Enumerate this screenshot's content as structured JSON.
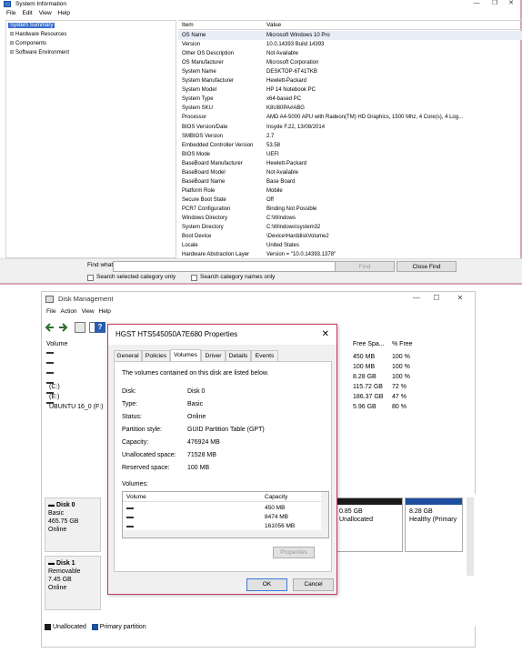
{
  "sysinfo": {
    "title": "System Information",
    "menu": [
      "File",
      "Edit",
      "View",
      "Help"
    ],
    "window_buttons": [
      "—",
      "❐",
      "✕"
    ],
    "tree": [
      {
        "label": "System Summary",
        "selected": true,
        "expander": ""
      },
      {
        "label": "Hardware Resources",
        "selected": false,
        "expander": "⊞"
      },
      {
        "label": "Components",
        "selected": false,
        "expander": "⊞"
      },
      {
        "label": "Software Environment",
        "selected": false,
        "expander": "⊞"
      }
    ],
    "columns": {
      "item": "Item",
      "value": "Value"
    },
    "rows": [
      {
        "item": "OS Name",
        "value": "Microsoft Windows 10 Pro"
      },
      {
        "item": "Version",
        "value": "10.0.14393 Build 14393"
      },
      {
        "item": "Other OS Description",
        "value": "Not Available"
      },
      {
        "item": "OS Manufacturer",
        "value": "Microsoft Corporation"
      },
      {
        "item": "System Name",
        "value": "DESKTOP-6T41TKB"
      },
      {
        "item": "System Manufacturer",
        "value": "Hewlett-Packard"
      },
      {
        "item": "System Model",
        "value": "HP 14 Notebook PC"
      },
      {
        "item": "System Type",
        "value": "x64-based PC"
      },
      {
        "item": "System SKU",
        "value": "K8U80PA#ABG"
      },
      {
        "item": "Processor",
        "value": "AMD A4-5000 APU with Radeon(TM) HD Graphics, 1500 Mhz, 4 Core(s), 4 Log..."
      },
      {
        "item": "BIOS Version/Date",
        "value": "Insyde F.22, 13/08/2014"
      },
      {
        "item": "SMBIOS Version",
        "value": "2.7"
      },
      {
        "item": "Embedded Controller Version",
        "value": "53.58"
      },
      {
        "item": "BIOS Mode",
        "value": "UEFI"
      },
      {
        "item": "BaseBoard Manufacturer",
        "value": "Hewlett-Packard"
      },
      {
        "item": "BaseBoard Model",
        "value": "Not Available"
      },
      {
        "item": "BaseBoard Name",
        "value": "Base Board"
      },
      {
        "item": "Platform Role",
        "value": "Mobile"
      },
      {
        "item": "Secure Boot State",
        "value": "Off"
      },
      {
        "item": "PCR7 Configuration",
        "value": "Binding Not Possible"
      },
      {
        "item": "Windows Directory",
        "value": "C:\\Windows"
      },
      {
        "item": "System Directory",
        "value": "C:\\Windows\\system32"
      },
      {
        "item": "Boot Device",
        "value": "\\Device\\HarddiskVolume2"
      },
      {
        "item": "Locale",
        "value": "United States"
      },
      {
        "item": "Hardware Abstraction Layer",
        "value": "Version = \"10.0.14393.1378\""
      }
    ],
    "find": {
      "label": "Find what:",
      "value": "",
      "find_button": "Find",
      "close_find_button": "Close Find",
      "search_selected_label": "Search selected category only",
      "search_names_label": "Search category names only"
    }
  },
  "diskmgmt": {
    "title": "Disk Management",
    "menu": [
      "File",
      "Action",
      "View",
      "Help"
    ],
    "window_buttons": [
      "—",
      "☐",
      "✕"
    ],
    "columns": {
      "volume": "Volume",
      "free": "Free Spa...",
      "pct_free": "% Free"
    },
    "volumes": [
      {
        "name": "",
        "free": "450 MB",
        "pct": "100 %"
      },
      {
        "name": "",
        "free": "100 MB",
        "pct": "100 %"
      },
      {
        "name": "",
        "free": "8.28 GB",
        "pct": "100 %"
      },
      {
        "name": "(C:)",
        "free": "115.72 GB",
        "pct": "72 %"
      },
      {
        "name": "(E:)",
        "free": "186.37 GB",
        "pct": "47 %"
      },
      {
        "name": "UBUNTU 16_0 (F:)",
        "free": "5.96 GB",
        "pct": "80 %"
      }
    ],
    "disk0": {
      "name": "Disk 0",
      "type": "Basic",
      "size": "465.75 GB",
      "status": "Online"
    },
    "disk0_parts": [
      {
        "line1": "0.85 GB",
        "line2": "Unallocated"
      },
      {
        "line1": "8.28 GB",
        "line2": "Healthy (Primary"
      }
    ],
    "disk1": {
      "name": "Disk 1",
      "type": "Removable",
      "size": "7.45 GB",
      "status": "Online"
    },
    "legend": {
      "unallocated": "Unallocated",
      "primary": "Primary partition"
    }
  },
  "dialog": {
    "title": "HGST HTS545050A7E680 Properties",
    "tabs": [
      "General",
      "Policies",
      "Volumes",
      "Driver",
      "Details",
      "Events"
    ],
    "active_tab": "Volumes",
    "intro": "The volumes contained on this disk are listed below.",
    "props": [
      {
        "label": "Disk:",
        "value": "Disk 0"
      },
      {
        "label": "Type:",
        "value": "Basic"
      },
      {
        "label": "Status:",
        "value": "Online"
      },
      {
        "label": "Partition style:",
        "value": "GUID Partition Table (GPT)"
      },
      {
        "label": "Capacity:",
        "value": "476924 MB"
      },
      {
        "label": "Unallocated space:",
        "value": "71528 MB"
      },
      {
        "label": "Reserved space:",
        "value": "100 MB"
      }
    ],
    "volumes_label": "Volumes:",
    "vol_columns": {
      "volume": "Volume",
      "capacity": "Capacity"
    },
    "vol_rows": [
      {
        "capacity": "450 MB"
      },
      {
        "capacity": "8474 MB"
      },
      {
        "capacity": "161056 MB"
      }
    ],
    "properties_button": "Properties",
    "ok_button": "OK",
    "cancel_button": "Cancel"
  },
  "colors": {
    "selection": "#3b6fce",
    "dialog_border": "#c33c5a",
    "primary_partition": "#1e4ea0",
    "unallocated": "#1a1a1a"
  }
}
